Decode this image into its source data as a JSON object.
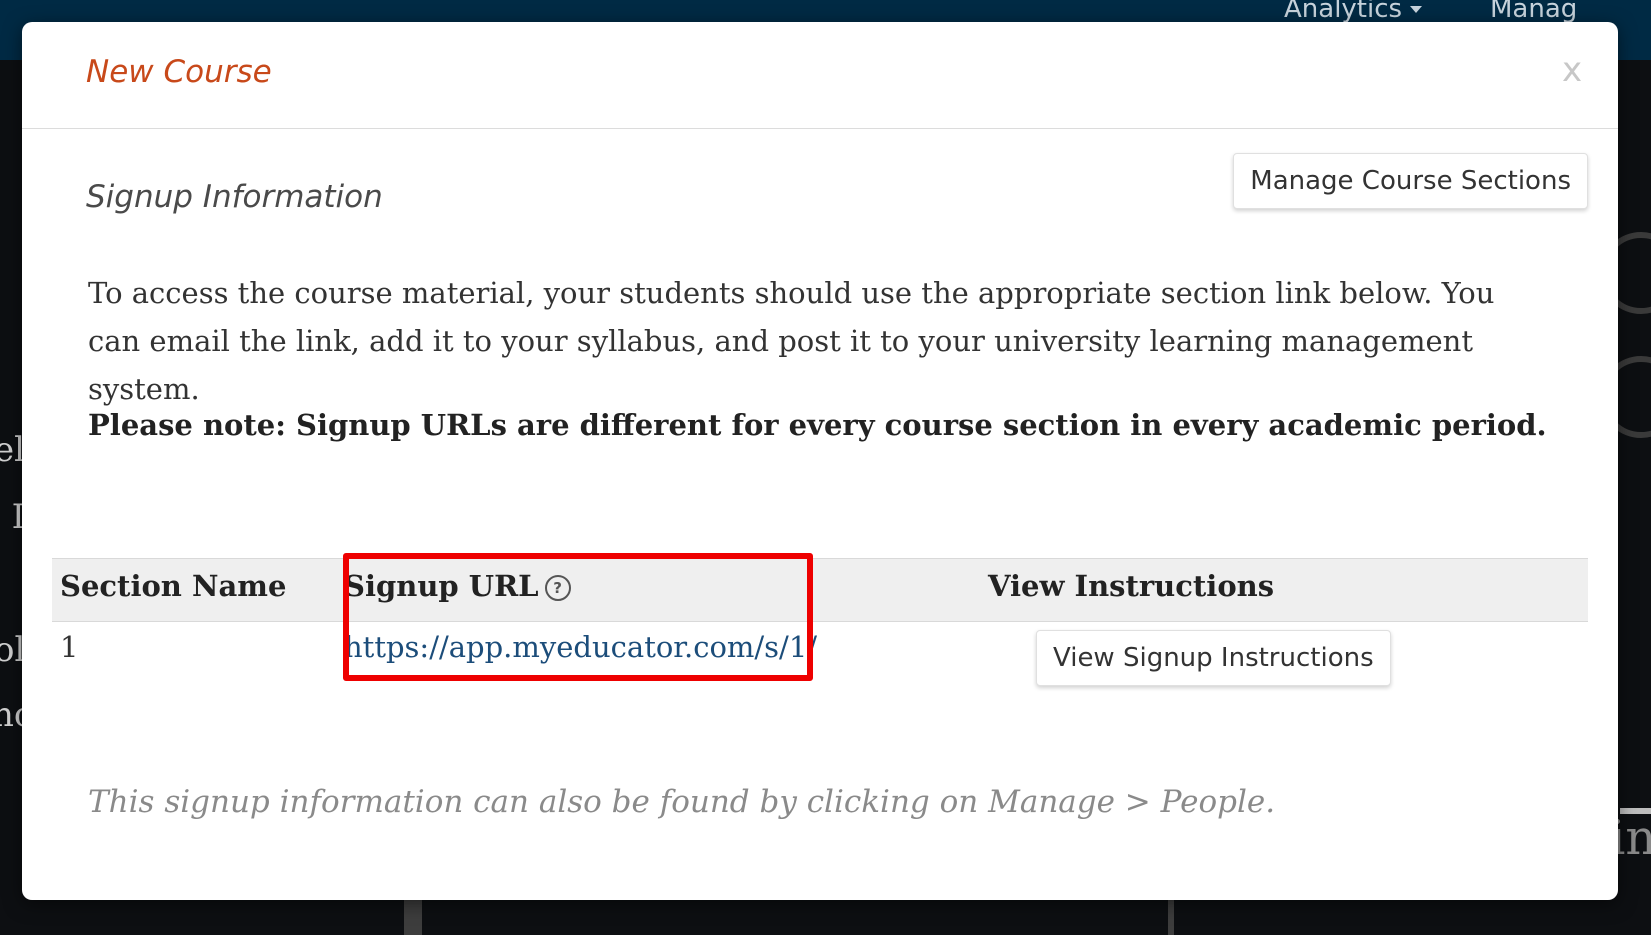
{
  "topbar": {
    "analytics_label": "Analytics",
    "manage_label": "Manag"
  },
  "background": {
    "frag_el": "el",
    "frag_l": "l I",
    "frag_ol": "ol",
    "frag_nc": "nc",
    "frag_in": "in"
  },
  "modal": {
    "title": "New Course",
    "close_label": "x",
    "section_title": "Signup Information",
    "manage_button": "Manage Course Sections",
    "intro": "To access the course material, your students should use the appropriate section link below. You can email the link, add it to your syllabus, and post it to your university learning management system.",
    "note": "Please note: Signup URLs are different for every course section in every academic period.",
    "table": {
      "headers": {
        "section_name": "Section Name",
        "signup_url": "Signup URL",
        "view_instructions": "View Instructions"
      },
      "help_icon_glyph": "?",
      "rows": [
        {
          "section": "1",
          "url": "https://app.myeducator.com/s/1/",
          "button": "View Signup Instructions"
        }
      ]
    },
    "footer": "This signup information can also be found by clicking on Manage > People."
  },
  "colors": {
    "title": "#c8491a",
    "link": "#1c4d7a",
    "highlight": "#ee0000",
    "topbar": "#002a44"
  },
  "icons": {
    "help": "question-circle-icon",
    "caret": "caret-down-icon",
    "close": "close-icon"
  }
}
